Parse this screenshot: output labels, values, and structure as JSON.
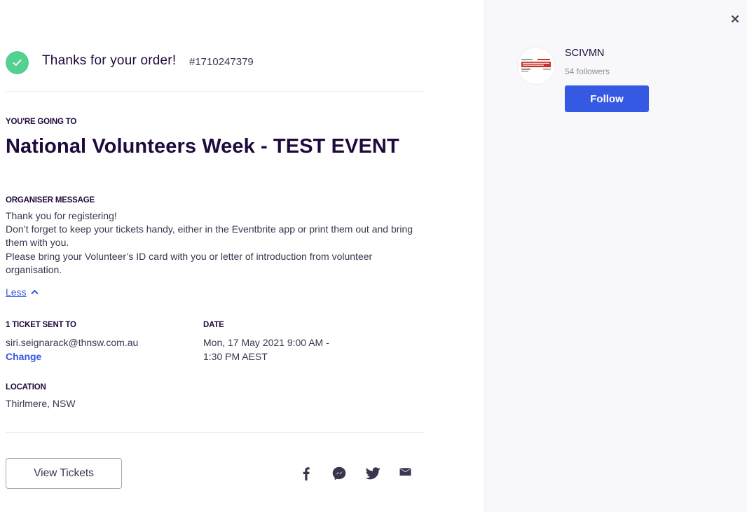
{
  "confirmation": {
    "thanks_text": "Thanks for your order!",
    "order_number": "#1710247379"
  },
  "event": {
    "going_label": "YOU'RE GOING TO",
    "title": "National Volunteers Week - TEST EVENT"
  },
  "organiser_message": {
    "label": "ORGANISER MESSAGE",
    "lines": [
      "Thank you for registering!",
      "Don’t forget to keep your tickets handy, either in the Eventbrite app or print them out and bring them with you.",
      "Please bring your Volunteer’s ID card with you or letter of introduction from volunteer organisation."
    ],
    "less_link": "Less"
  },
  "tickets": {
    "label": "1 TICKET SENT TO",
    "email": "siri.seignarack@thnsw.com.au",
    "change_link": "Change"
  },
  "date": {
    "label": "DATE",
    "line1": "Mon, 17 May 2021 9:00 AM -",
    "line2": "1:30 PM AEST"
  },
  "location": {
    "label": "LOCATION",
    "value": "Thirlmere, NSW"
  },
  "actions": {
    "view_tickets": "View Tickets",
    "share_icons": [
      "facebook-icon",
      "messenger-icon",
      "twitter-icon",
      "email-icon"
    ]
  },
  "organizer": {
    "name": "SCIVMN",
    "followers": "54 followers",
    "follow_label": "Follow",
    "logo_text": "VOLUNTEER"
  },
  "colors": {
    "brand_blue": "#3659e3",
    "success_green": "#54d192",
    "heading": "#1e0a3c",
    "panel_bg": "#f8f7fa"
  }
}
